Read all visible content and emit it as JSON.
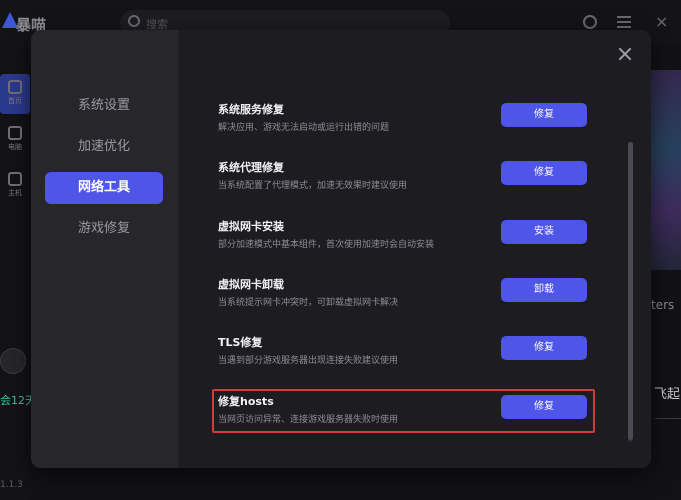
{
  "background": {
    "app_title": "暴喵",
    "search_placeholder": "搜索",
    "sidebar": [
      {
        "label": "首页",
        "icon": "home-icon"
      },
      {
        "label": "电脑",
        "icon": "monitor-icon"
      },
      {
        "label": "主机",
        "icon": "gamepad-icon"
      }
    ],
    "member_days": "会12天",
    "version": "1.1.3",
    "right_text_1": "ters",
    "right_text_2": "飞起"
  },
  "settings": {
    "nav": [
      {
        "label": "系统设置",
        "active": false
      },
      {
        "label": "加速优化",
        "active": false
      },
      {
        "label": "网络工具",
        "active": true
      },
      {
        "label": "游戏修复",
        "active": false
      }
    ],
    "tools": [
      {
        "title": "系统服务修复",
        "desc": "解决应用、游戏无法启动或运行出错的问题",
        "button": "修复"
      },
      {
        "title": "系统代理修复",
        "desc": "当系统配置了代理模式，加速无效果时建议使用",
        "button": "修复"
      },
      {
        "title": "虚拟网卡安装",
        "desc": "部分加速模式中基本组件，首次使用加速时会自动安装",
        "button": "安装"
      },
      {
        "title": "虚拟网卡卸载",
        "desc": "当系统提示网卡冲突时，可卸载虚拟网卡解决",
        "button": "卸载"
      },
      {
        "title": "TLS修复",
        "desc": "当遇到部分游戏服务器出现连接失败建议使用",
        "button": "修复"
      },
      {
        "title": "修复hosts",
        "desc": "当网页访问异常、连接游戏服务器失败时使用",
        "button": "修复"
      }
    ]
  },
  "colors": {
    "accent": "#4f55e6",
    "highlight": "#d6383d",
    "dialog_bg": "#26262b",
    "content_bg": "#1c1c21"
  }
}
